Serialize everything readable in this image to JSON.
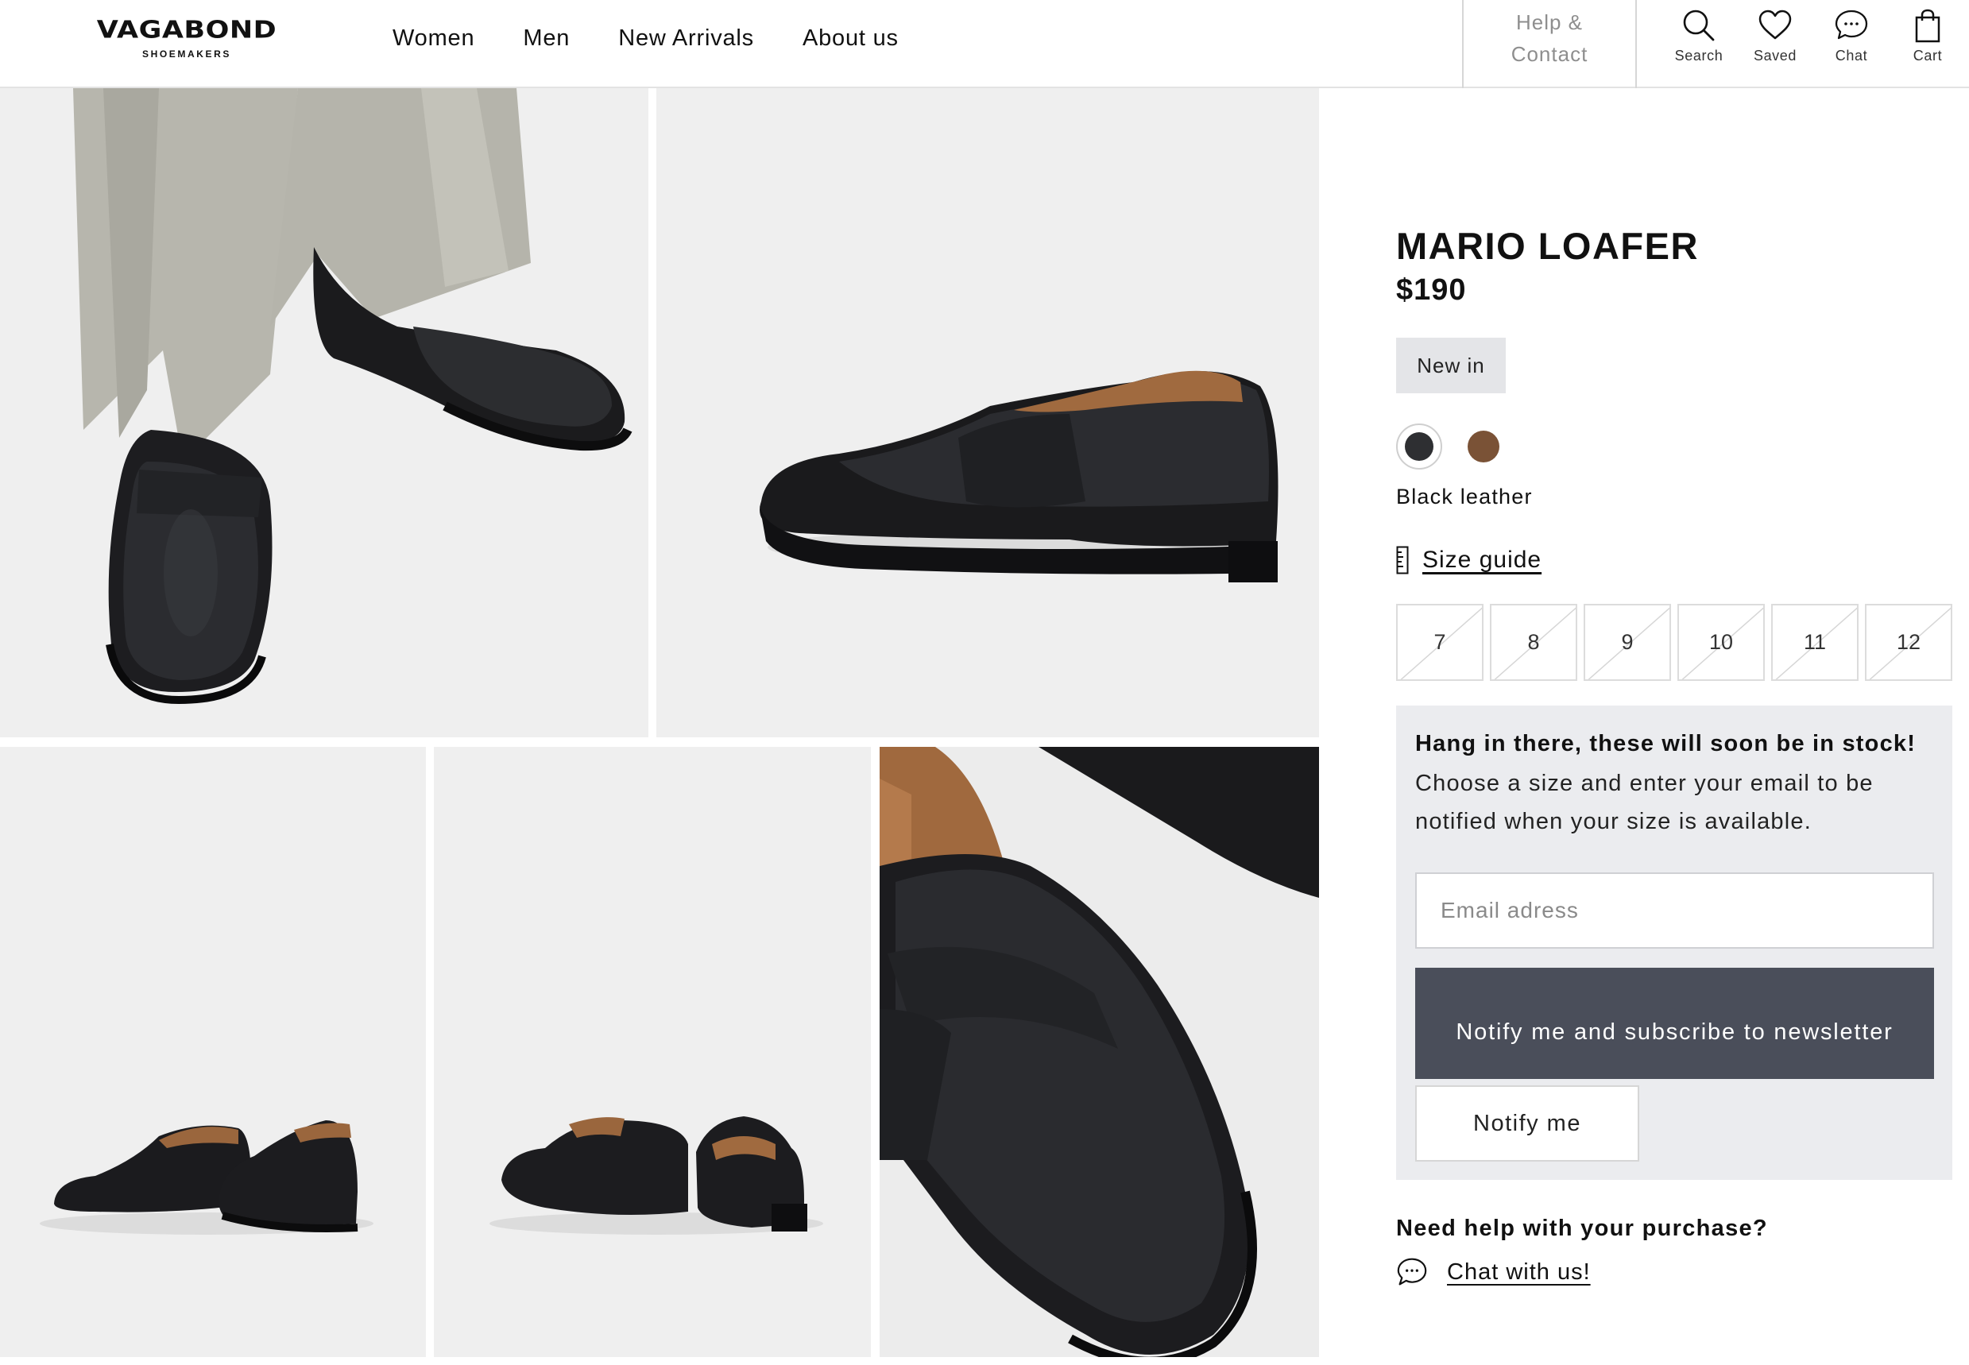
{
  "brand": {
    "name": "VAGABOND",
    "tagline": "SHOEMAKERS"
  },
  "nav": {
    "items": [
      {
        "label": "Women"
      },
      {
        "label": "Men"
      },
      {
        "label": "New Arrivals"
      },
      {
        "label": "About us"
      }
    ]
  },
  "help": {
    "line1": "Help &",
    "line2": "Contact"
  },
  "header_icons": [
    {
      "label": "Search",
      "icon": "search-icon"
    },
    {
      "label": "Saved",
      "icon": "heart-icon"
    },
    {
      "label": "Chat",
      "icon": "chat-icon"
    },
    {
      "label": "Cart",
      "icon": "bag-icon"
    }
  ],
  "product": {
    "title": "MARIO LOAFER",
    "price": "$190",
    "badge": "New in",
    "colors": [
      {
        "name": "Black leather",
        "hex": "#2e2f32",
        "selected": true
      },
      {
        "name": "Brown",
        "hex": "#7a5236",
        "selected": false
      }
    ],
    "selected_color_label": "Black leather",
    "size_guide_label": "Size guide",
    "sizes": [
      {
        "label": "7",
        "available": false
      },
      {
        "label": "8",
        "available": false
      },
      {
        "label": "9",
        "available": false
      },
      {
        "label": "10",
        "available": false
      },
      {
        "label": "11",
        "available": false
      },
      {
        "label": "12",
        "available": false
      }
    ]
  },
  "stock_notice": {
    "heading": "Hang in there, these will soon be in stock!",
    "text": "Choose a size and enter your email to be notified when your size is available.",
    "email_placeholder": "Email adress",
    "subscribe_button": "Notify me and subscribe to newsletter",
    "notify_button": "Notify me"
  },
  "support": {
    "question": "Need help with your purchase?",
    "chat_link": "Chat with us!"
  },
  "gallery": [
    {
      "name": "model-wearing-loafers-photo"
    },
    {
      "name": "loafer-side-view-photo"
    },
    {
      "name": "loafers-pair-front-photo"
    },
    {
      "name": "loafers-pair-back-photo"
    },
    {
      "name": "loafer-closeup-photo"
    }
  ],
  "colors": {
    "accent_dark": "#4a4e5a",
    "panel_bg": "#ebecef",
    "badge_bg": "#e4e5e8"
  }
}
